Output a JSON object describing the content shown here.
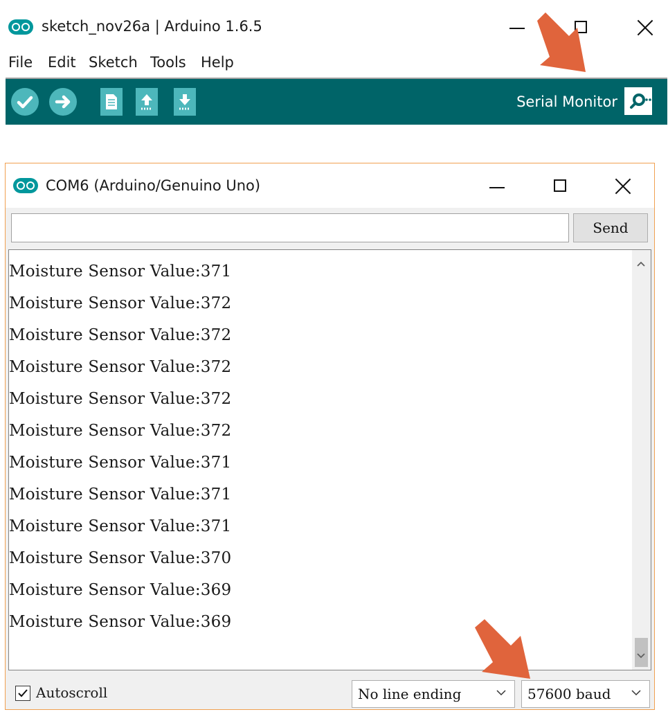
{
  "ide": {
    "title": "sketch_nov26a | Arduino 1.6.5",
    "menu": [
      "File",
      "Edit",
      "Sketch",
      "Tools",
      "Help"
    ],
    "toolbar": {
      "serial_monitor_label": "Serial Monitor"
    }
  },
  "serial_monitor": {
    "title": "COM6 (Arduino/Genuino Uno)",
    "input_value": "",
    "send_label": "Send",
    "lines": [
      "Moisture Sensor Value:371",
      "Moisture Sensor Value:372",
      "Moisture Sensor Value:372",
      "Moisture Sensor Value:372",
      "Moisture Sensor Value:372",
      "Moisture Sensor Value:372",
      "Moisture Sensor Value:371",
      "Moisture Sensor Value:371",
      "Moisture Sensor Value:371",
      "Moisture Sensor Value:370",
      "Moisture Sensor Value:369",
      "Moisture Sensor Value:369"
    ],
    "autoscroll_label": "Autoscroll",
    "autoscroll_checked": true,
    "line_ending_selected": "No line ending",
    "baud_selected": "57600 baud"
  },
  "colors": {
    "toolbar": "#006468",
    "toolbar_button": "#4db7bb",
    "arduino_logo": "#00979c",
    "annotation_arrow": "#e0643c"
  },
  "icons": [
    "arduino-logo-icon",
    "verify-check-icon",
    "upload-arrow-icon",
    "new-file-icon",
    "open-file-icon",
    "save-file-icon",
    "serial-monitor-magnifier-icon",
    "minimize-icon",
    "maximize-icon",
    "close-icon",
    "chevron-down-icon",
    "scroll-up-icon",
    "scroll-down-icon",
    "checkmark-icon",
    "annotation-arrow-icon"
  ]
}
